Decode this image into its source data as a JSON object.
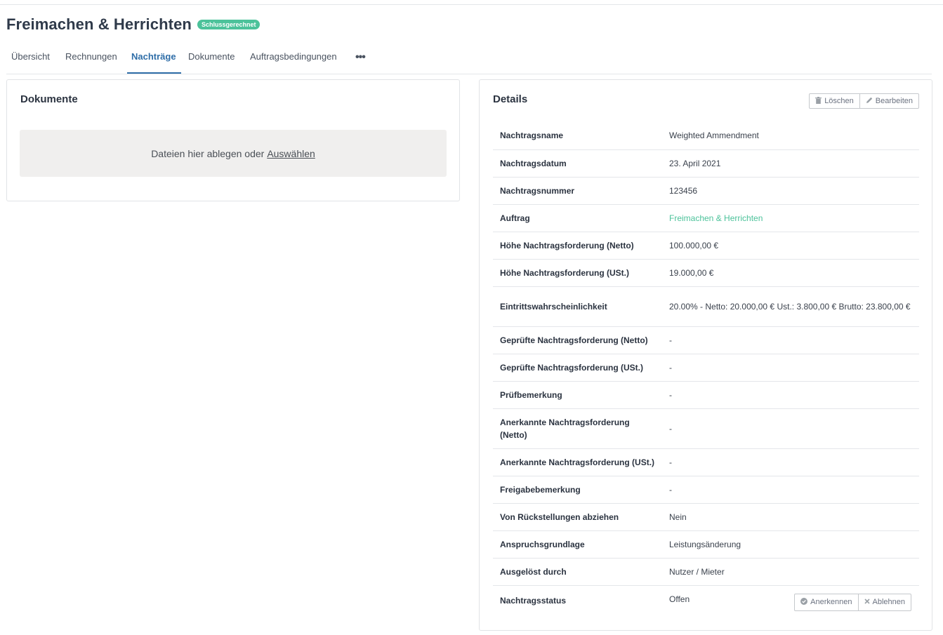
{
  "header": {
    "title": "Freimachen & Herrichten",
    "badge": "Schlussgerechnet"
  },
  "tabs": [
    {
      "label": "Übersicht"
    },
    {
      "label": "Rechnungen"
    },
    {
      "label": "Nachträge",
      "active": true
    },
    {
      "label": "Dokumente"
    },
    {
      "label": "Auftragsbedingungen"
    }
  ],
  "more_icon": "ellipsis-icon",
  "documents_panel": {
    "title": "Dokumente",
    "dropzone_text": "Dateien hier ablegen oder",
    "dropzone_link": "Auswählen"
  },
  "details_panel": {
    "title": "Details",
    "delete_label": "Löschen",
    "edit_label": "Bearbeiten",
    "rows": [
      {
        "label": "Nachtragsname",
        "value": "Weighted Ammendment"
      },
      {
        "label": "Nachtragsdatum",
        "value": "23. April 2021"
      },
      {
        "label": "Nachtragsnummer",
        "value": "123456"
      },
      {
        "label": "Auftrag",
        "value": "Freimachen & Herrichten"
      },
      {
        "label": "Höhe Nachtragsforderung (Netto)",
        "value": "100.000,00 €"
      },
      {
        "label": "Höhe Nachtragsforderung (USt.)",
        "value": "19.000,00 €"
      },
      {
        "label": "Eintrittswahrscheinlichkeit",
        "value": "20.00% - Netto: 20.000,00 € Ust.: 3.800,00 € Brutto: 23.800,00 €"
      },
      {
        "label": "Geprüfte Nachtragsforderung (Netto)",
        "value": "-"
      },
      {
        "label": "Geprüfte Nachtragsforderung (USt.)",
        "value": "-"
      },
      {
        "label": "Prüfbemerkung",
        "value": "-"
      },
      {
        "label": "Anerkannte Nachtragsforderung (Netto)",
        "value": "-"
      },
      {
        "label": "Anerkannte Nachtragsforderung (USt.)",
        "value": "-"
      },
      {
        "label": "Freigabebemerkung",
        "value": "-"
      },
      {
        "label": "Von Rückstellungen abziehen",
        "value": "Nein"
      },
      {
        "label": "Anspruchsgrundlage",
        "value": "Leistungsänderung"
      },
      {
        "label": "Ausgelöst durch",
        "value": "Nutzer / Mieter"
      },
      {
        "label": "Nachtragsstatus",
        "value": "Offen"
      }
    ],
    "accept_label": "Anerkennen",
    "reject_label": "Ablehnen"
  },
  "colors": {
    "accent_green": "#4cc29a",
    "active_tab": "#2f6ea8"
  }
}
